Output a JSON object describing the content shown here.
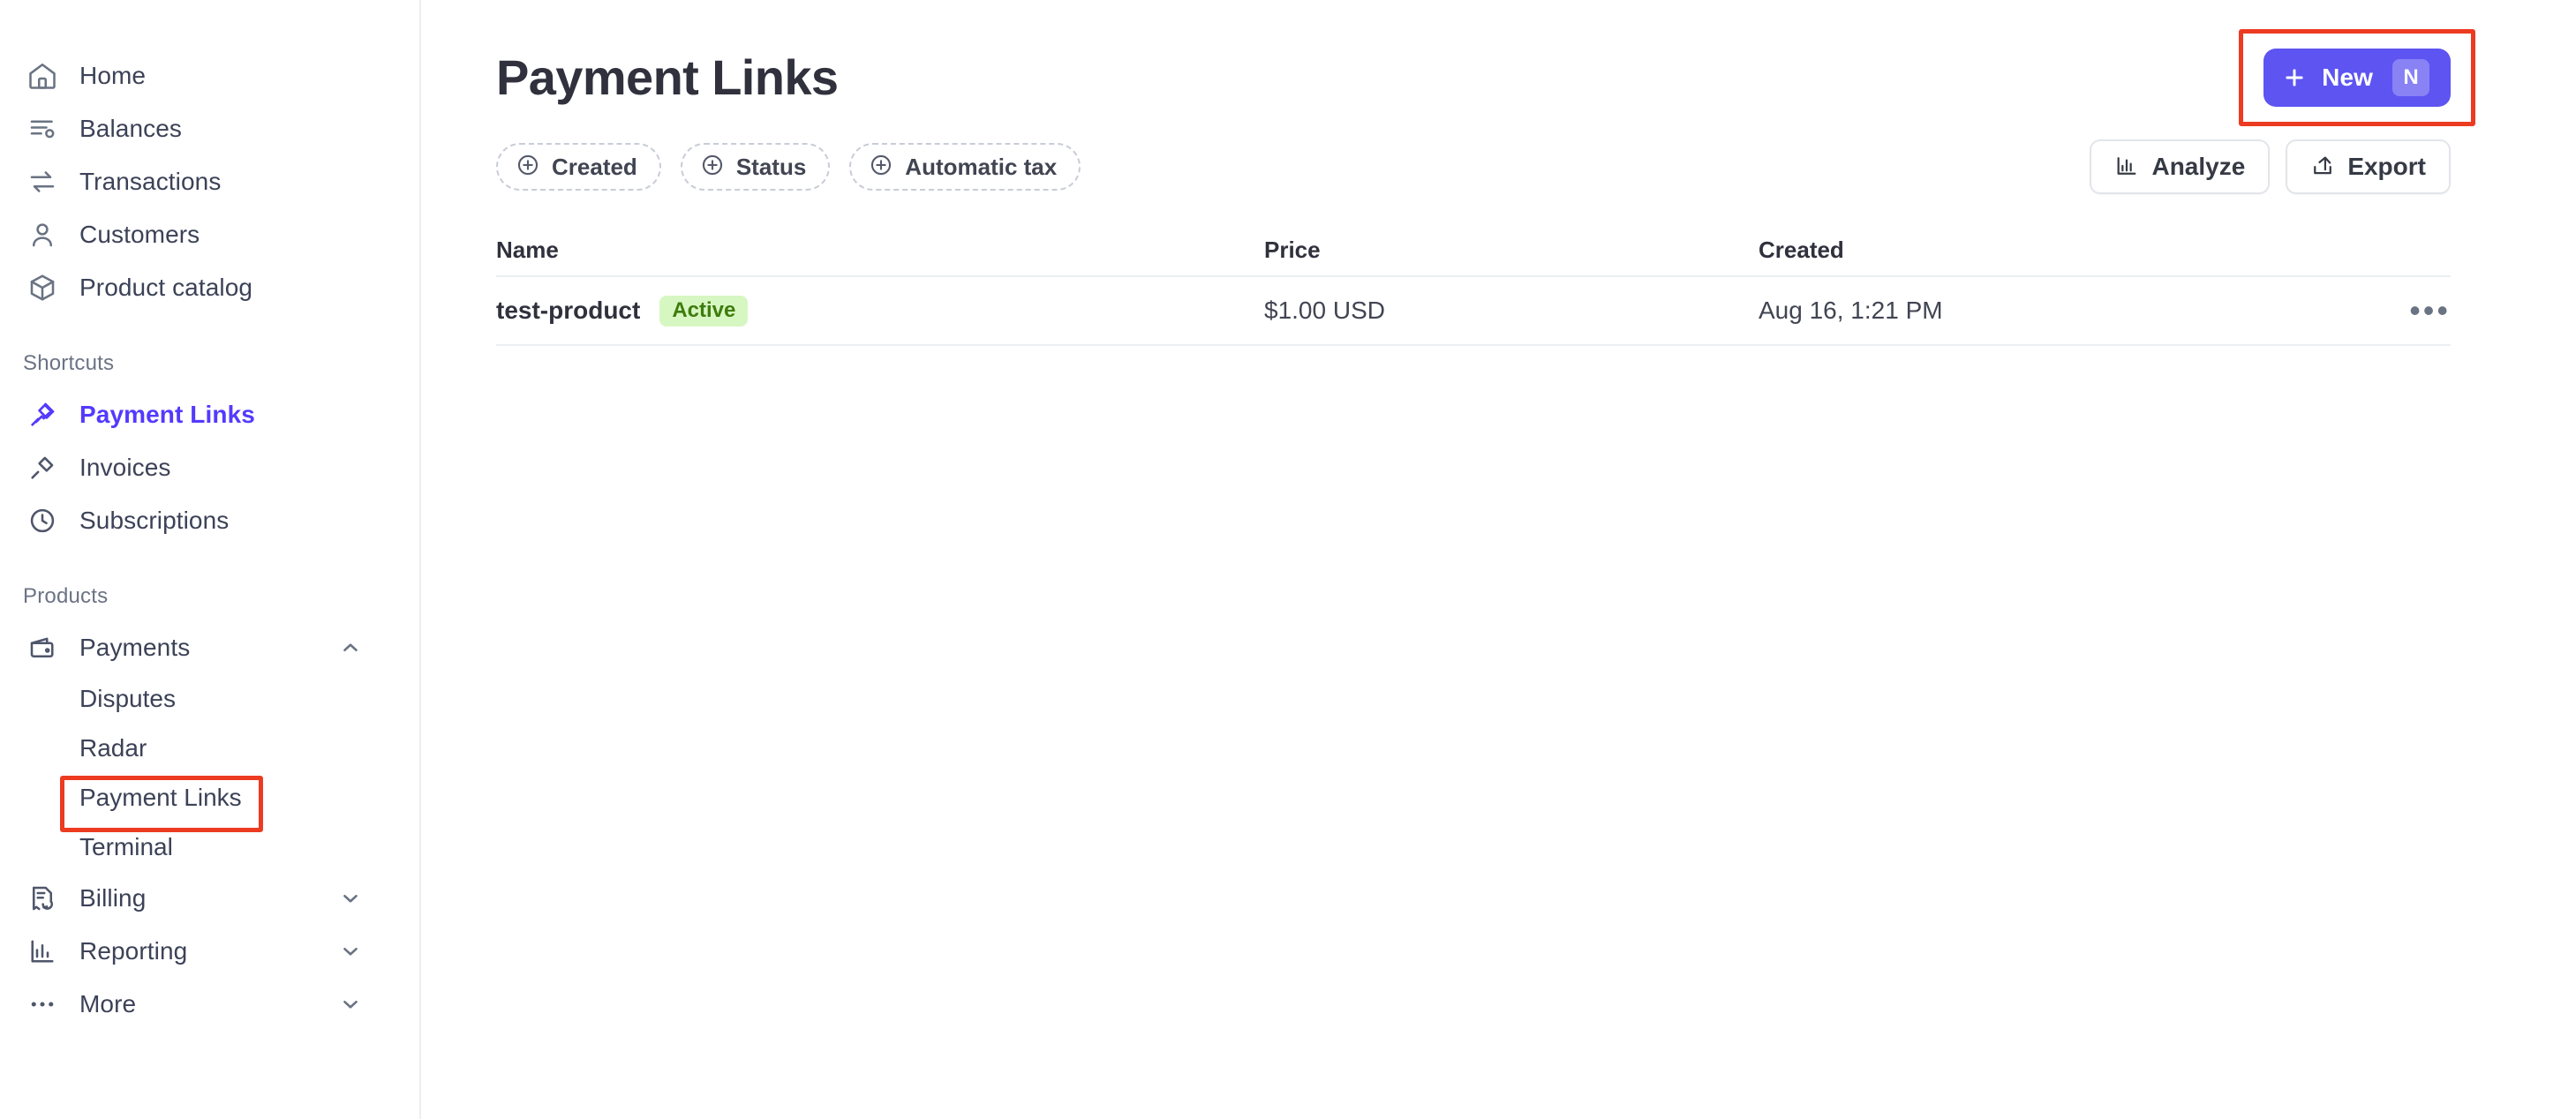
{
  "sidebar": {
    "primary_items": [
      {
        "label": "Home",
        "icon": "home-icon"
      },
      {
        "label": "Balances",
        "icon": "balances-icon"
      },
      {
        "label": "Transactions",
        "icon": "transactions-icon"
      },
      {
        "label": "Customers",
        "icon": "customers-icon"
      },
      {
        "label": "Product catalog",
        "icon": "product-catalog-icon"
      }
    ],
    "shortcuts_label": "Shortcuts",
    "shortcuts": [
      {
        "label": "Payment Links",
        "icon": "pin-icon",
        "active": true
      },
      {
        "label": "Invoices",
        "icon": "pin-icon",
        "active": false
      },
      {
        "label": "Subscriptions",
        "icon": "clock-icon",
        "active": false
      }
    ],
    "products_label": "Products",
    "products": [
      {
        "label": "Payments",
        "icon": "wallet-icon",
        "chevron": "chevron-up-icon"
      },
      {
        "label": "Billing",
        "icon": "billing-icon",
        "chevron": "chevron-down-icon"
      },
      {
        "label": "Reporting",
        "icon": "reporting-icon",
        "chevron": "chevron-down-icon"
      },
      {
        "label": "More",
        "icon": "more-icon",
        "chevron": "chevron-down-icon"
      }
    ],
    "payments_subitems": [
      {
        "label": "Disputes",
        "highlighted": false
      },
      {
        "label": "Radar",
        "highlighted": false
      },
      {
        "label": "Payment Links",
        "highlighted": true
      },
      {
        "label": "Terminal",
        "highlighted": false
      }
    ]
  },
  "header": {
    "title": "Payment Links",
    "new_button": {
      "label": "New",
      "shortcut_key": "N",
      "icon": "plus-icon",
      "color": "#5d54f1",
      "highlighted": true
    }
  },
  "filters": [
    {
      "label": "Created",
      "icon": "plus-circle-icon"
    },
    {
      "label": "Status",
      "icon": "plus-circle-icon"
    },
    {
      "label": "Automatic tax",
      "icon": "plus-circle-icon"
    }
  ],
  "toolbar_actions": [
    {
      "label": "Analyze",
      "icon": "bar-chart-icon"
    },
    {
      "label": "Export",
      "icon": "export-icon"
    }
  ],
  "table": {
    "columns": [
      "Name",
      "Price",
      "Created"
    ],
    "rows": [
      {
        "name": "test-product",
        "status": "Active",
        "status_bg": "#d7f7c2",
        "status_fg": "#3d7c0d",
        "price": "$1.00 USD",
        "created": "Aug 16, 1:21 PM",
        "menu_icon": "ellipsis-icon"
      }
    ]
  },
  "annotation": {
    "color": "#ec3b21"
  }
}
